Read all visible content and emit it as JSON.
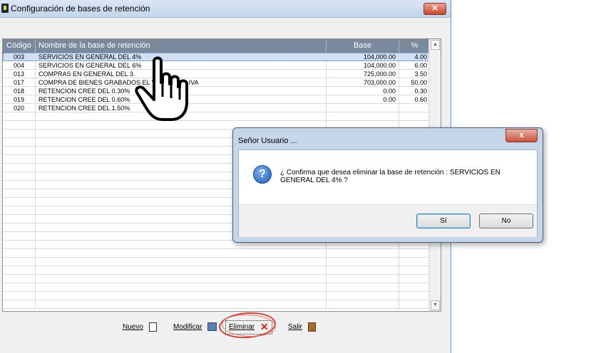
{
  "window": {
    "title": "Configuración de bases de retención",
    "close_glyph": "✕"
  },
  "grid": {
    "columns": [
      "Código",
      "Nombre de la base de retención",
      "Base",
      "%"
    ],
    "rows": [
      {
        "code": "003",
        "name": "SERVICIOS EN GENERAL DEL 4%",
        "base": "104,000.00",
        "pct": "4.00",
        "selected": true
      },
      {
        "code": "004",
        "name": "SERVICIOS EN GENERAL DEL 6%",
        "base": "104,000.00",
        "pct": "6.00"
      },
      {
        "code": "013",
        "name": "COMPRAS EN GENERAL DEL 3.",
        "base": "725,000.00",
        "pct": "3.50"
      },
      {
        "code": "017",
        "name": "COMPRA DE BIENES GRABADOS          EL VALOR DEL IVA",
        "base": "703,000.00",
        "pct": "50.00"
      },
      {
        "code": "018",
        "name": "RETENCION CREE DEL 0.30%",
        "base": "0.00",
        "pct": "0.30"
      },
      {
        "code": "019",
        "name": "RETENCION CREE DEL 0.60%",
        "base": "0.00",
        "pct": "0.60"
      },
      {
        "code": "020",
        "name": "RETENCION CREE DEL 1.50%",
        "base": "",
        "pct": ""
      }
    ]
  },
  "toolbar": {
    "nuevo_label": "Nuevo",
    "modificar_label": "Modificar",
    "eliminar_label": "Eliminar",
    "eliminar_icon_glyph": "✕",
    "salir_label": "Salir"
  },
  "dialog": {
    "title": "Señor Usuario ...",
    "close_glyph": "x",
    "icon_glyph": "?",
    "message": "¿ Confirma que desea eliminar la base de retención : SERVICIOS EN GENERAL DEL 4% ?",
    "yes_label": "Sí",
    "no_label": "No"
  },
  "colors": {
    "header_bg": "#7a8a9c",
    "selected_row": "#cfe0f7",
    "highlight_ring": "#d0443a"
  },
  "icons": [
    "app-icon",
    "new-document-icon",
    "edit-icon",
    "delete-x-icon",
    "exit-door-icon",
    "question-icon",
    "hand-pointer-icon",
    "scroll-up-icon",
    "scroll-down-icon"
  ]
}
